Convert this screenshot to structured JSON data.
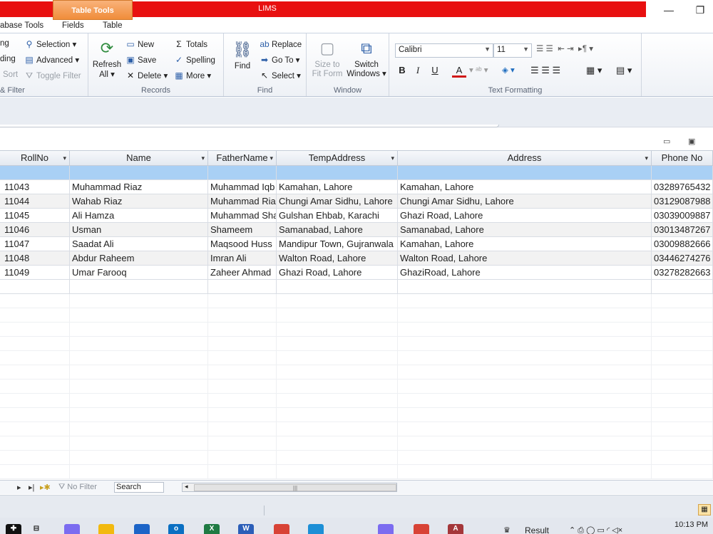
{
  "window": {
    "app_title": "LIMS",
    "context_tab": "Table Tools",
    "minimize": "—",
    "restore": "❐"
  },
  "ribbon_tabs": [
    "abase Tools",
    "Fields",
    "Table"
  ],
  "ribbon": {
    "sort_filter": {
      "label": "& Filter",
      "items": [
        "ng",
        "ding",
        "Sort"
      ],
      "selection": "Selection",
      "advanced": "Advanced",
      "toggle_filter": "Toggle Filter"
    },
    "records": {
      "label": "Records",
      "refresh": "Refresh",
      "refresh_all": "All",
      "new": "New",
      "save": "Save",
      "delete": "Delete",
      "totals": "Totals",
      "spelling": "Spelling",
      "more": "More"
    },
    "find": {
      "label": "Find",
      "find": "Find",
      "replace": "Replace",
      "go_to": "Go To",
      "select": "Select"
    },
    "window": {
      "label": "Window",
      "size_to": "Size to",
      "fit_form": "Fit Form",
      "switch": "Switch",
      "windows": "Windows"
    },
    "text_formatting": {
      "label": "Text Formatting",
      "font": "Calibri",
      "size": "11",
      "bold": "B",
      "italic": "I",
      "underline": "U",
      "font_color": "A"
    }
  },
  "datasheet": {
    "columns": [
      "RollNo",
      "Name",
      "FatherName",
      "TempAddress",
      "Address",
      "Phone No"
    ],
    "rows": [
      [
        "11043",
        "Muhammad Riaz",
        "Muhammad Iqb",
        "Kamahan, Lahore",
        "Kamahan, Lahore",
        "03289765432"
      ],
      [
        "11044",
        "Wahab Riaz",
        "Muhammad Ria",
        "Chungi Amar Sidhu, Lahore",
        "Chungi Amar Sidhu, Lahore",
        "03129087988"
      ],
      [
        "11045",
        "Ali Hamza",
        "Muhammad Sha",
        "Gulshan Ehbab, Karachi",
        "Ghazi Road, Lahore",
        "03039009887"
      ],
      [
        "11046",
        "Usman",
        "Shameem",
        "Samanabad, Lahore",
        "Samanabad, Lahore",
        "03013487267"
      ],
      [
        "11047",
        "Saadat Ali",
        "Maqsood Huss",
        "Mandipur Town, Gujranwala",
        "Kamahan, Lahore",
        "03009882666"
      ],
      [
        "11048",
        "Abdur Raheem",
        "Imran Ali",
        "Walton Road, Lahore",
        "Walton Road, Lahore",
        "03446274276"
      ],
      [
        "11049",
        "Umar Farooq",
        "Zaheer Ahmad",
        "Ghazi Road, Lahore",
        "GhaziRoad, Lahore",
        "03278282663"
      ]
    ]
  },
  "navbar": {
    "no_filter": "No Filter",
    "search": "Search"
  },
  "taskbar": {
    "result": "Result",
    "time": "10:13 PM"
  }
}
